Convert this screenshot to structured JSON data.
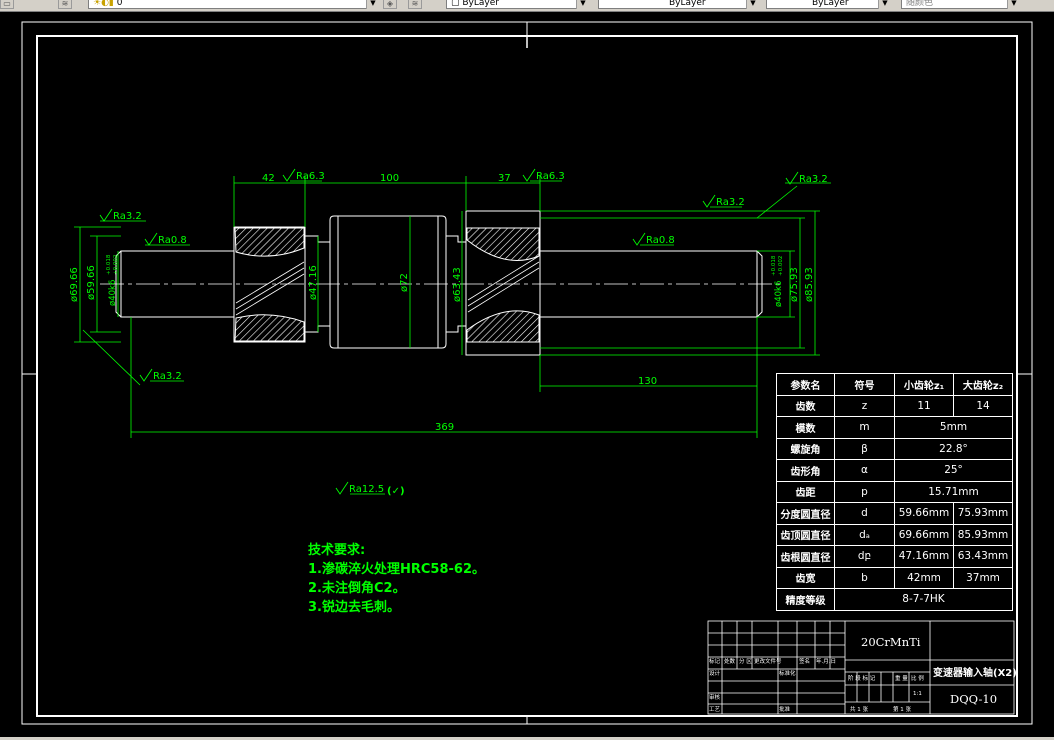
{
  "toolbar": {
    "layer_value": "0",
    "color_value": "ByLayer",
    "linetype_value": "ByLayer",
    "lineweight_value": "ByLayer",
    "plotstyle_value": "随颜色"
  },
  "drawing": {
    "dimensions": {
      "d42": "42",
      "d100": "100",
      "d37": "37",
      "d130": "130",
      "d369": "369",
      "dia6966": "ø69.66",
      "dia5966": "ø59.66",
      "dia40k6_left": "ø40k6",
      "tol_left_top": "+0.018",
      "tol_left_bot": "+0.002",
      "dia4716": "ø47.16",
      "dia72": "ø72",
      "dia6343": "ø63.43",
      "dia40k6_right": "ø40k6",
      "tol_right_top": "+0.018",
      "tol_right_bot": "+0.002",
      "dia7593": "ø75.93",
      "dia8593": "ø85.93"
    },
    "roughness": {
      "r_left_top": "Ra3.2",
      "r_left_08": "Ra0.8",
      "r_gear1": "Ra6.3",
      "r_gear2": "Ra6.3",
      "r_right_top1": "Ra3.2",
      "r_right_top2": "Ra3.2",
      "r_right_08": "Ra0.8",
      "r_left_bottom": "Ra3.2",
      "r_general": "Ra12.5",
      "r_general_suffix": "(✓)"
    }
  },
  "technical_requirements": {
    "title": "技术要求:",
    "items": [
      "1.渗碳淬火处理HRC58-62。",
      "2.未注倒角C2。",
      "3.锐边去毛刺。"
    ]
  },
  "parameter_table": {
    "headers": [
      "参数名",
      "符号",
      "小齿轮z₁",
      "大齿轮z₂"
    ],
    "rows": [
      {
        "name": "齿数",
        "symbol": "z",
        "v1": "11",
        "v2": "14"
      },
      {
        "name": "模数",
        "symbol": "m",
        "merged": "5mm"
      },
      {
        "name": "螺旋角",
        "symbol": "β",
        "merged": "22.8°"
      },
      {
        "name": "齿形角",
        "symbol": "α",
        "merged": "25°"
      },
      {
        "name": "齿距",
        "symbol": "p",
        "merged": "15.71mm"
      },
      {
        "name": "分度圆直径",
        "symbol": "d",
        "v1": "59.66mm",
        "v2": "75.93mm"
      },
      {
        "name": "齿顶圆直径",
        "symbol": "dₐ",
        "v1": "69.66mm",
        "v2": "85.93mm"
      },
      {
        "name": "齿根圆直径",
        "symbol": "dբ",
        "v1": "47.16mm",
        "v2": "63.43mm"
      },
      {
        "name": "齿宽",
        "symbol": "b",
        "v1": "42mm",
        "v2": "37mm"
      }
    ],
    "precision_label": "精度等级",
    "precision_value": "8-7-7HK"
  },
  "title_block": {
    "material": "20CrMnTi",
    "part_name": "变速器输入轴(X2)",
    "drawing_no": "DQQ-10",
    "scale": "1:1",
    "sheet_of": "共 1 张",
    "sheet_no": "第 1 张",
    "row_labels": [
      "标记",
      "处数",
      "分 区",
      "更改文件号",
      "签名",
      "年.月.日"
    ],
    "designer_label": "设计",
    "standard_label": "标准化",
    "review_label": "审核",
    "process_label": "工艺",
    "approve_label": "批准",
    "stage_labels": [
      "阶 段 标 记",
      "重 量",
      "比 例"
    ]
  },
  "colors": {
    "dimension": "#00ff00",
    "outline": "#ffffff",
    "background": "#000000",
    "toolbar": "#d4d0c8"
  }
}
